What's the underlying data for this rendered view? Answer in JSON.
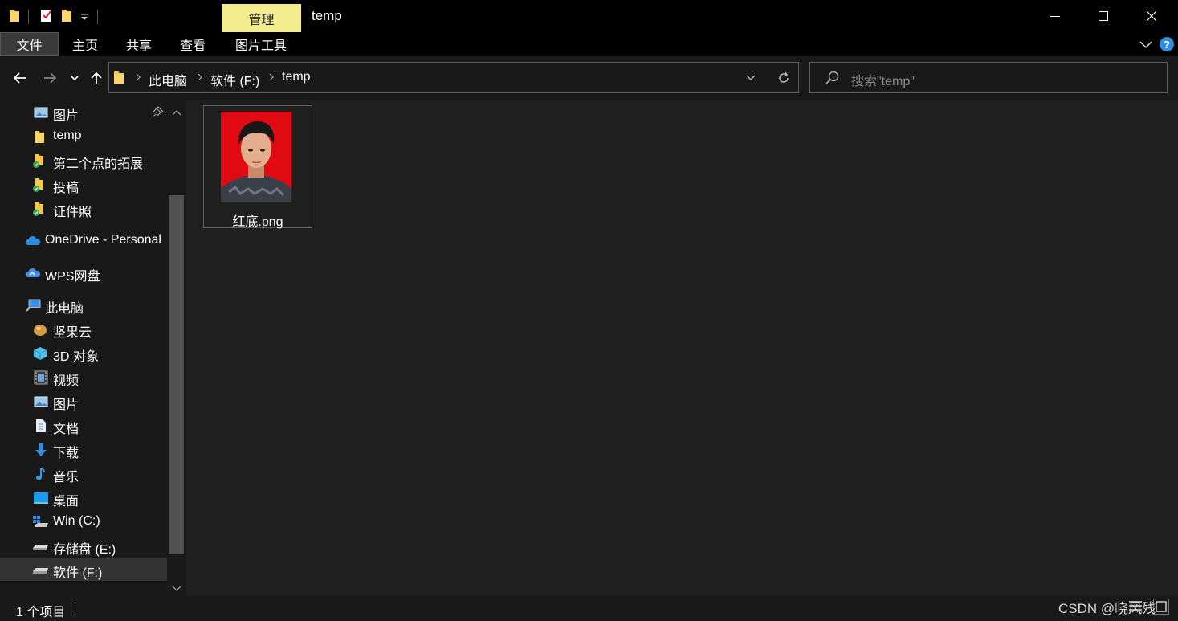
{
  "window": {
    "title": "temp",
    "context_tab": "管理",
    "controls": {
      "minimize": "minimize",
      "maximize": "maximize",
      "close": "close"
    }
  },
  "ribbon": {
    "tabs": [
      "文件",
      "主页",
      "共享",
      "查看",
      "图片工具"
    ],
    "help": "?"
  },
  "address_bar": {
    "breadcrumbs": [
      "此电脑",
      "软件 (F:)",
      "temp"
    ]
  },
  "search": {
    "placeholder": "搜索\"temp\""
  },
  "sidebar": {
    "items": [
      {
        "label": "图片",
        "icon": "pictures-icon",
        "pinned": true
      },
      {
        "label": "temp",
        "icon": "folder-icon"
      },
      {
        "label": "第二个点的拓展",
        "icon": "folder-synced-icon"
      },
      {
        "label": "投稿",
        "icon": "folder-synced-icon"
      },
      {
        "label": "证件照",
        "icon": "folder-synced-icon"
      },
      {
        "label": "OneDrive - Personal",
        "icon": "onedrive-cloud-icon"
      },
      {
        "label": "WPS网盘",
        "icon": "wps-cloud-icon"
      },
      {
        "label": "此电脑",
        "icon": "this-pc-icon"
      },
      {
        "label": "坚果云",
        "icon": "nutstore-icon"
      },
      {
        "label": "3D 对象",
        "icon": "3d-objects-icon"
      },
      {
        "label": "视频",
        "icon": "videos-icon"
      },
      {
        "label": "图片",
        "icon": "pictures-icon"
      },
      {
        "label": "文档",
        "icon": "documents-icon"
      },
      {
        "label": "下载",
        "icon": "downloads-icon"
      },
      {
        "label": "音乐",
        "icon": "music-icon"
      },
      {
        "label": "桌面",
        "icon": "desktop-icon"
      },
      {
        "label": "Win (C:)",
        "icon": "windows-drive-icon"
      },
      {
        "label": "存储盘 (E:)",
        "icon": "drive-icon"
      },
      {
        "label": "软件 (F:)",
        "icon": "drive-icon",
        "selected": true
      }
    ]
  },
  "files": [
    {
      "name": "红底.png",
      "thumbnail_background": "#e10a12"
    }
  ],
  "status": {
    "item_count": "1 个项目"
  },
  "watermark": "CSDN @晓风残",
  "colors": {
    "context_tab_bg": "#f3ec8e",
    "titlebar_bg": "#000000",
    "content_bg": "#202020",
    "sidebar_bg": "#191919",
    "folder_yellow": "#f6c74a",
    "accent_blue": "#2f8ee0"
  }
}
